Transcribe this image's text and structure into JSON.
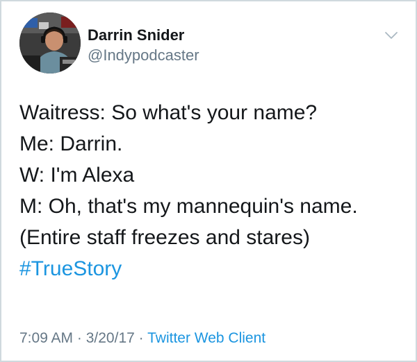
{
  "author": {
    "display_name": "Darrin Snider",
    "handle": "@Indypodcaster",
    "avatar_icon": "profile-photo"
  },
  "tweet": {
    "lines": [
      "Waitress: So what's your name?",
      "Me: Darrin.",
      "W: I'm Alexa",
      "M: Oh, that's my mannequin's name.",
      "(Entire staff freezes and stares)"
    ],
    "hashtag": "#TrueStory"
  },
  "meta": {
    "time": "7:09 AM",
    "separator_1": " · ",
    "date": "3/20/17",
    "separator_2": " · ",
    "client": "Twitter Web Client"
  },
  "menu": {
    "icon": "chevron-down-icon"
  },
  "colors": {
    "link": "#1b95e0",
    "secondary_text": "#657786",
    "primary_text": "#14171a",
    "border": "#cfd9de"
  }
}
